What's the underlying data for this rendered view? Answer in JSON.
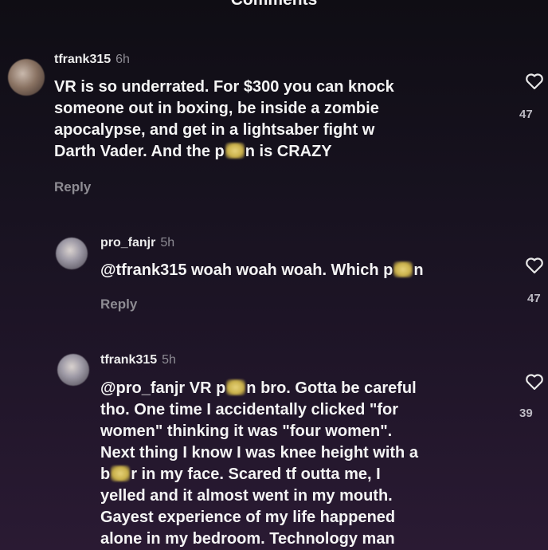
{
  "header": {
    "title": "Comments"
  },
  "comments": [
    {
      "username": "tfrank315",
      "time": "6h",
      "text_part1": "VR is so underrated. For $300 you can knock\nsomeone out in boxing, be inside a zombie\napocalypse, and get in a lightsaber fight w\nDarth Vader. And the p",
      "text_part2": "n is CRAZY",
      "reply_label": "Reply",
      "likes": "47"
    },
    {
      "username": "pro_fanjr",
      "time": "5h",
      "text_part1": "@tfrank315 woah woah woah. Which p",
      "text_part2": "n",
      "reply_label": "Reply",
      "likes": "47"
    },
    {
      "username": "tfrank315",
      "time": "5h",
      "text_part1": "@pro_fanjr VR p",
      "text_part2": "n bro. Gotta be careful\ntho. One time I accidentally clicked \"for\nwomen\" thinking it was \"four women\".\nNext thing I know I was knee height with a\nb",
      "text_part3": "r in my face. Scared tf outta me, I\nyelled and it almost went in my mouth.\nGayest experience of my life happened\nalone in my bedroom. Technology man",
      "likes": "39"
    }
  ],
  "icons": {
    "heart": "heart-icon"
  },
  "colors": {
    "background": "#17121f",
    "muted": "#8e8c93",
    "text": "#f4f4f4"
  }
}
